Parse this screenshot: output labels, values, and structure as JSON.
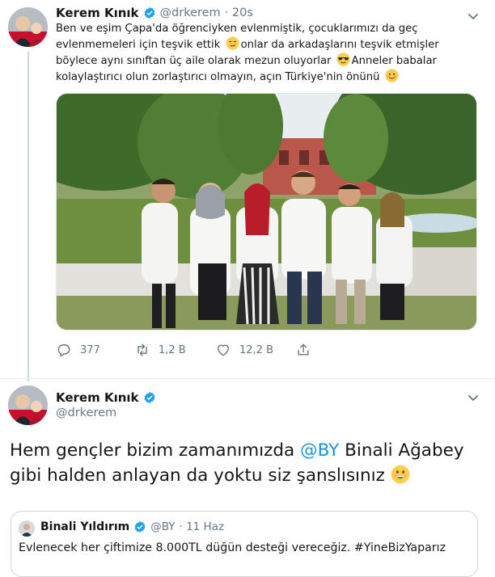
{
  "tweet1": {
    "author_name": "Kerem Kınık",
    "author_handle": "@drkerem",
    "time": "· 20s",
    "text_lines": [
      "Ben ve eşim Çapa'da öğrenciyken evlenmiştik, çocuklarımızı da geç",
      "evlenmemeleri için teşvik ettik",
      "onlar da arkadaşlarını teşvik etmişler",
      "böylece aynı sınıftan üç aile olarak mezun oluyorlar",
      "Anneler babalar",
      "kolaylaştırıcı olun zorlaştırıcı olmayın, açın Türkiye'nin önünü"
    ],
    "actions": {
      "replies": "377",
      "retweets": "1,2 B",
      "likes": "12,2 B"
    }
  },
  "tweet2": {
    "author_name": "Kerem Kınık",
    "author_handle": "@drkerem",
    "text_part1": "Hem gençler bizim zamanımızda ",
    "mention": "@BY",
    "text_part2": " Binali Ağabey",
    "text_line2": "gibi halden anlayan da yoktu siz şanslısınız"
  },
  "quoted": {
    "author_name": "Binali Yıldırım",
    "author_handle": "@BY",
    "date": "· 11 Haz",
    "text": "Evlenecek her çiftimize 8.000TL düğün desteği vereceğiz. #YineBizYaparız"
  },
  "colors": {
    "accent": "#1da1f2",
    "mention": "#1b95e0",
    "secondary_text": "#657786",
    "divider": "#e6ecf0"
  },
  "icons": [
    "verified-badge-icon",
    "chevron-down-icon",
    "reply-icon",
    "retweet-icon",
    "like-icon",
    "share-icon",
    "emoji-smirk",
    "emoji-sunglasses",
    "emoji-smile",
    "emoji-grin"
  ]
}
